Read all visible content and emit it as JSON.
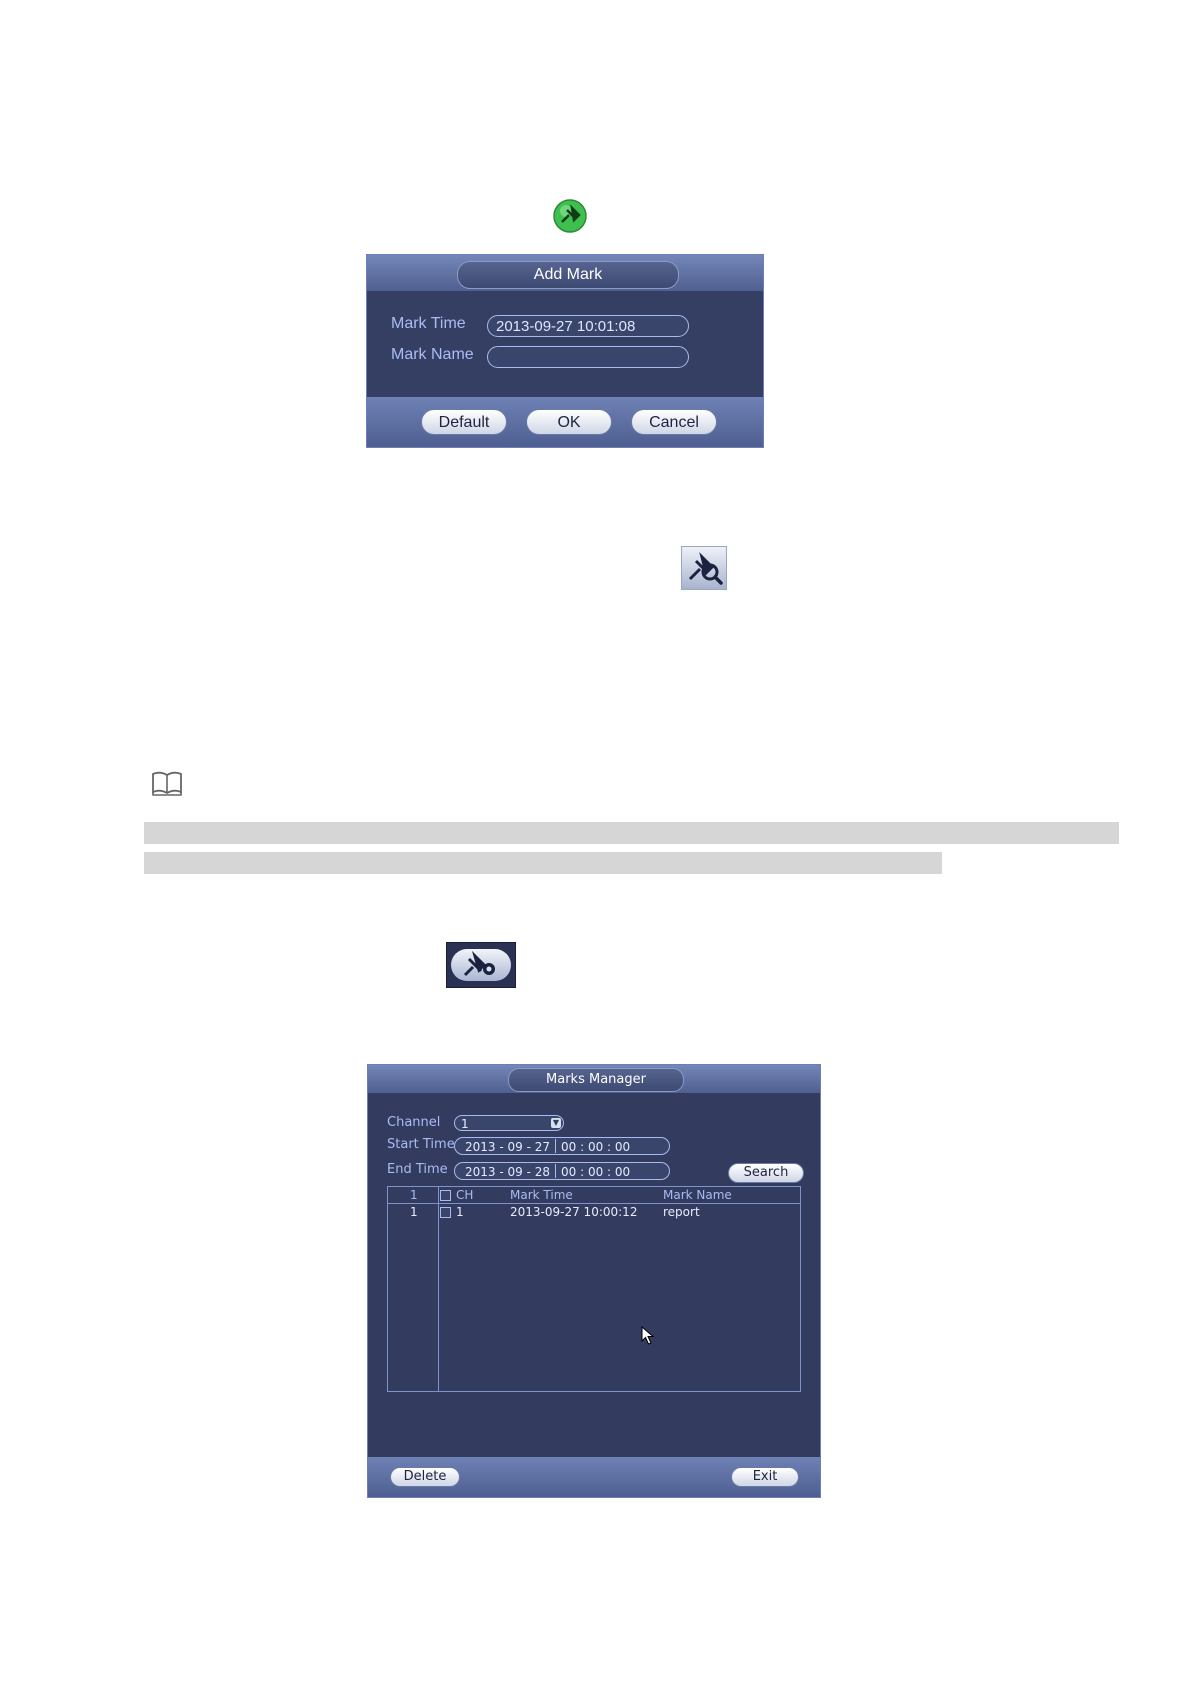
{
  "add_mark_dialog": {
    "title": "Add Mark",
    "mark_time_label": "Mark Time",
    "mark_time_value": "2013-09-27 10:01:08",
    "mark_name_label": "Mark Name",
    "mark_name_value": "",
    "buttons": {
      "default": "Default",
      "ok": "OK",
      "cancel": "Cancel"
    }
  },
  "marks_manager": {
    "title": "Marks Manager",
    "channel_label": "Channel",
    "channel_value": "1",
    "start_time_label": "Start Time",
    "start_date": "2013 -  09  -  27",
    "start_time": "00  :  00  :  00",
    "end_time_label": "End Time",
    "end_date": "2013 -  09  -  28",
    "end_time": "00  :  00  :  00",
    "search_label": "Search",
    "table": {
      "headers": {
        "index": "1",
        "ch": "CH",
        "mark_time": "Mark Time",
        "mark_name": "Mark Name"
      },
      "rows": [
        {
          "index": "1",
          "ch": "1",
          "mark_time": "2013-09-27 10:00:12",
          "mark_name": "report"
        }
      ]
    },
    "delete_label": "Delete",
    "exit_label": "Exit"
  },
  "icons": {
    "add_mark": "add-mark-icon",
    "mark_search": "mark-search-icon",
    "note": "note-book-icon",
    "marks_manager": "marks-manager-icon",
    "cursor": "mouse-cursor-icon"
  }
}
